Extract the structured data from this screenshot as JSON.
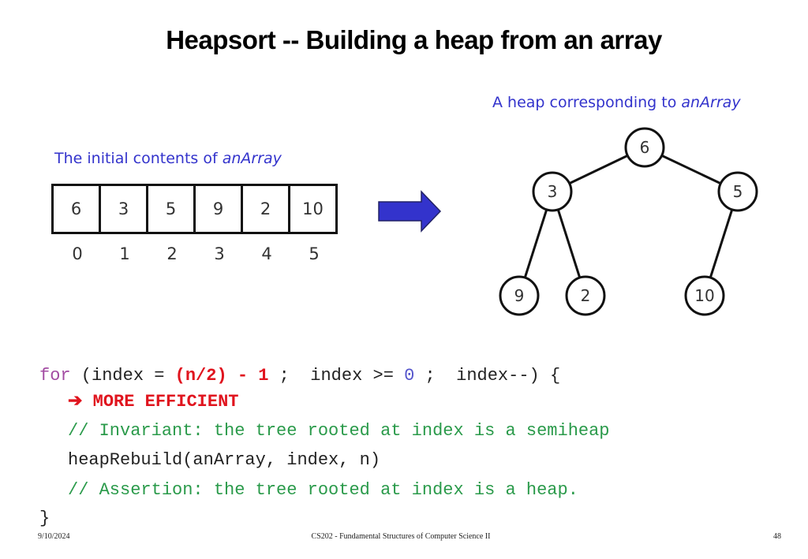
{
  "slide": {
    "title": "Heapsort -- Building a heap from an array",
    "array_caption": {
      "text": "The initial contents of ",
      "emph": "anArray"
    },
    "heap_caption": {
      "text": "A heap corresponding to ",
      "emph": "anArray"
    },
    "array": {
      "values": [
        "6",
        "3",
        "5",
        "9",
        "2",
        "10"
      ],
      "indices": [
        "0",
        "1",
        "2",
        "3",
        "4",
        "5"
      ]
    },
    "arrow_color": "#3333cc",
    "heap_tree": {
      "nodes": [
        {
          "id": "n0",
          "value": "6"
        },
        {
          "id": "n1",
          "value": "3"
        },
        {
          "id": "n2",
          "value": "5"
        },
        {
          "id": "n3",
          "value": "9"
        },
        {
          "id": "n4",
          "value": "2"
        },
        {
          "id": "n5",
          "value": "10"
        }
      ],
      "edges": [
        [
          "n0",
          "n1"
        ],
        [
          "n0",
          "n2"
        ],
        [
          "n1",
          "n3"
        ],
        [
          "n1",
          "n4"
        ],
        [
          "n2",
          "n5"
        ]
      ]
    },
    "code": {
      "line1": {
        "kw": "for",
        "a": " (index = ",
        "init": "(n/2) - 1",
        "b": " ;  index >= ",
        "zero": "0",
        "c": " ;  index--) {"
      },
      "line2": {
        "arrow": "➔",
        "text": " MORE EFFICIENT"
      },
      "line3": "// Invariant: the tree rooted at index is a semiheap",
      "line4": "heapRebuild(anArray, index, n)",
      "line5": "// Assertion: the tree rooted at index is a heap.",
      "line6": "}"
    },
    "colors": {
      "caption": "#3333cc",
      "keyword": "#a34ca3",
      "highlight": "#e0141e",
      "comment": "#2a9a4a",
      "number": "#5555cc"
    }
  },
  "footer": {
    "date": "9/10/2024",
    "course": "CS202 - Fundamental Structures of Computer Science II",
    "page": "48"
  }
}
